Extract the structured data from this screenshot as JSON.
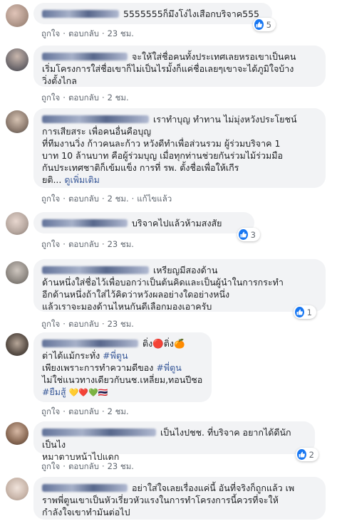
{
  "actions": {
    "like": "ถูกใจ",
    "reply": "ตอบกลับ",
    "edited": "แก้ไขแล้ว",
    "see_more": "ดูเพิ่มเติม"
  },
  "comments": [
    {
      "text": "5555555ก็มึงโง่ไงเสือกบริจาค555",
      "time": "23 ชม.",
      "likes": "5"
    },
    {
      "text": "จะให้ใส่ชื่อคนทั้งประเทศเลยหรอเขาเป็นคน\nเริ่มโครงการใส่ชื่อเขาก็ไม่เป็นไรมั้งก็แค่ชื่อเลยๆเขาจะได้ภูมิใจบ้าง\nวิ่งตั้งไกล",
      "time": "2 ชม."
    },
    {
      "text": "เราทำบุญ ทำทาน ไม่มุ่งหวังประโยชน์\nการเสียสระ เพื่อคนอื่นคือบุญ\nที่ทีมงานวิ่ง ก้าวคนละก้าว หวังดีทำเพื่อส่วนรวม ผู้ร่วมบริจาค 1\nบาท 10 ล้านบาท คือผู้ร่วมบุญ เมื่อทุกท่านช่วยกันร่วมไม้ร่วมมือ\nกันประเทศชาติก็เข้มแข็ง การที่ รพ. ตั้งชื่อเพื่อให้เกีร\nยติ...",
      "time": "2 ชม."
    },
    {
      "text": "บริจาคไปแล้วห้ามสงสัย",
      "time": "23 ชม.",
      "likes": "3"
    },
    {
      "text": "เหรียญมีสองด้าน\nด้านหนึ่งใส่ชื่อไว้เพื่อบอกว่าเป็นต้นคิดและเป็นผู้นำในการกระทำ\nอีกด้านหนึ่งถ้าใส่ไว้คิดว่าหวังผลอย่างใดอย่างหนึ่ง\nแล้วเราจะมองด้านไหนกันดีเลือกมองเอาครับ",
      "time": "23 ชม.",
      "likes": "1"
    },
    {
      "line1": "ติ่ง🔴ติ่ง🍊",
      "line2": "ต่าได้แม้กระทั่ง",
      "hashtag1": "#พี่ตูน",
      "line3a": "เพียงเพราะการทำความดีของ",
      "hashtag2": "#พี่ตูน",
      "line4": "ไม่ใช่แนวทางเดียวกับนช.เหลี่ยม,ทอนปีชอ",
      "hashtag3": "#ยืมสู้",
      "line5_emoji": "💛❤️💚🇹🇭",
      "time": "2 ชม."
    },
    {
      "text": "เป็นไงปชช. ที่บริจาค อยากได้ดีนัก เป็นไง\nหมาตาบหน้าไปแดก",
      "time": "23 ชม.",
      "likes": "2"
    },
    {
      "text": "อย่าใส่ใจเลยเรื่องแค่นี้ อันที่จริงก็ถูกแล้ว เพ\nราพพี่ตูนเขาเป็นหัวเรี่ยวหัวแรงในการทำโครงการนี้ควรที่จะให้\nกำลังใจเขาทำมันต่อไป"
    }
  ],
  "colors": {
    "link": "#385898",
    "meta": "#606770",
    "bubble": "#f2f3f5",
    "like": "#1877f2"
  }
}
